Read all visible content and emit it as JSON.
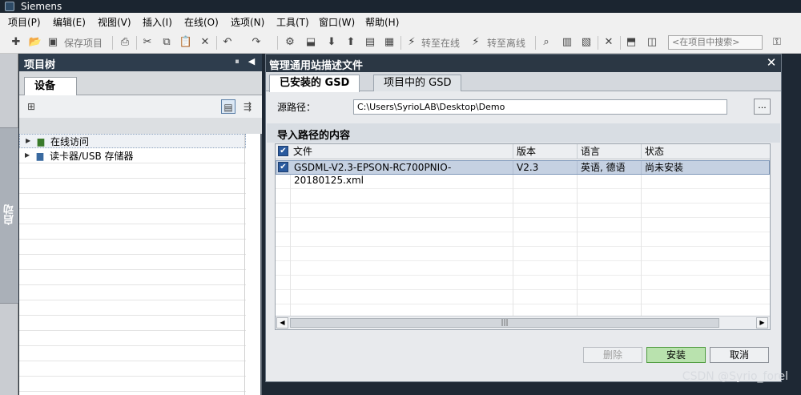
{
  "app": {
    "title": "Siemens"
  },
  "menu": [
    "项目(P)",
    "编辑(E)",
    "视图(V)",
    "插入(I)",
    "在线(O)",
    "选项(N)",
    "工具(T)",
    "窗口(W)",
    "帮助(H)"
  ],
  "toolbar": {
    "save_label": "保存项目",
    "go_online_label": "转至在线",
    "go_offline_label": "转至离线",
    "search_placeholder": "<在项目中搜索>"
  },
  "left_strip": {
    "start_label": "启动"
  },
  "project_tree": {
    "title": "项目树",
    "tab": "设备",
    "items": [
      {
        "label": "在线访问",
        "icon": "online-access-icon"
      },
      {
        "label": "读卡器/USB 存储器",
        "icon": "card-reader-icon"
      }
    ]
  },
  "dialog": {
    "title": "管理通用站描述文件",
    "tabs": [
      {
        "label": "已安装的 GSD",
        "active": true
      },
      {
        "label": "项目中的 GSD",
        "active": false
      }
    ],
    "source_path_label": "源路径：",
    "source_path_value": "C:\\Users\\SyrioLAB\\Desktop\\Demo",
    "browse_label": "...",
    "section_title": "导入路径的内容",
    "table": {
      "columns": [
        "文件",
        "版本",
        "语言",
        "状态"
      ],
      "rows": [
        {
          "checked": true,
          "file": "GSDML-V2.3-EPSON-RC700PNIO-20180125.xml",
          "version": "V2.3",
          "language": "英语, 德语",
          "status": "尚未安装"
        }
      ]
    },
    "buttons": {
      "delete": "删除",
      "install": "安装",
      "cancel": "取消"
    }
  },
  "watermark": "CSDN @Syrio_forel",
  "colors": {
    "title_bar": "#1b2530",
    "panel_header": "#2e3d4d",
    "selected_row": "#c5d1e2",
    "install_button": "#b9e2ae"
  }
}
